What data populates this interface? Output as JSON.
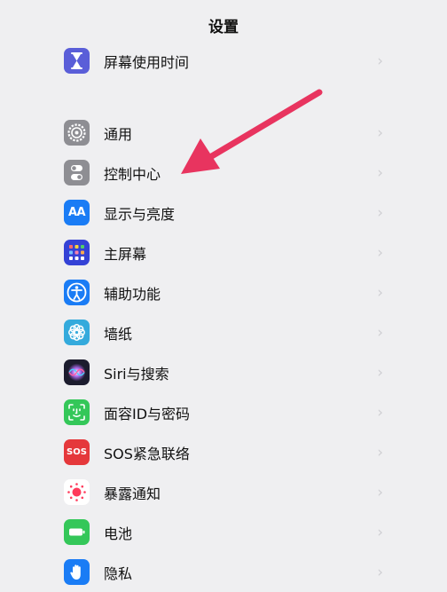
{
  "header": {
    "title": "设置"
  },
  "group1": {
    "items": [
      {
        "label": "屏幕使用时间",
        "icon": "hourglass-icon",
        "color": "#5856d6"
      }
    ]
  },
  "group2": {
    "items": [
      {
        "label": "通用",
        "icon": "gear-icon",
        "color": "#8e8e93"
      },
      {
        "label": "控制中心",
        "icon": "toggle-switches-icon",
        "color": "#8e8e93"
      },
      {
        "label": "显示与亮度",
        "icon": "text-size-icon",
        "color": "#1a7cf5"
      },
      {
        "label": "主屏幕",
        "icon": "app-grid-icon",
        "color": "#3442d6"
      },
      {
        "label": "辅助功能",
        "icon": "accessibility-icon",
        "color": "#1a7cf5"
      },
      {
        "label": "墙纸",
        "icon": "flower-icon",
        "color": "#34aadc"
      },
      {
        "label": "Siri与搜索",
        "icon": "siri-icon",
        "color": "#222222"
      },
      {
        "label": "面容ID与密码",
        "icon": "face-id-icon",
        "color": "#34c759"
      },
      {
        "label": "SOS紧急联络",
        "icon": "sos-icon",
        "color": "#e5383b"
      },
      {
        "label": "暴露通知",
        "icon": "exposure-icon",
        "color": "#ffffff"
      },
      {
        "label": "电池",
        "icon": "battery-icon",
        "color": "#34c759"
      },
      {
        "label": "隐私",
        "icon": "hand-icon",
        "color": "#1a7cf5"
      }
    ]
  },
  "icons": {
    "sos_text": "SOS",
    "aa_text": "AA"
  },
  "annotation": {
    "arrow_color": "#e8345f"
  }
}
